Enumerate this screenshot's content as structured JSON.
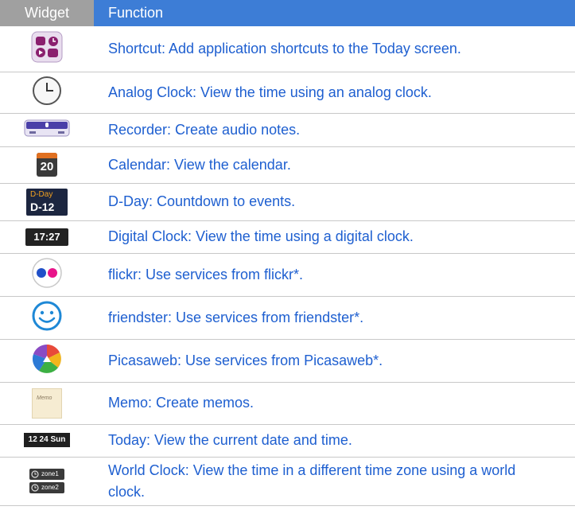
{
  "header": {
    "widget": "Widget",
    "function": "Function"
  },
  "rows": [
    {
      "icon": "shortcut-icon",
      "text": "Shortcut: Add application shortcuts to the Today screen."
    },
    {
      "icon": "analog-clock-icon",
      "text": "Analog Clock: View the time using an analog clock."
    },
    {
      "icon": "recorder-icon",
      "text": "Recorder: Create audio notes."
    },
    {
      "icon": "calendar-icon",
      "icon_text": "20",
      "text": "Calendar: View the calendar."
    },
    {
      "icon": "d-day-icon",
      "icon_text": "D-Day",
      "icon_text2": "D-12",
      "text": "D-Day: Countdown to events."
    },
    {
      "icon": "digital-clock-icon",
      "icon_text": "17:27",
      "text": "Digital Clock: View the time using a digital clock."
    },
    {
      "icon": "flickr-icon",
      "text": "flickr: Use services from flickr*."
    },
    {
      "icon": "friendster-icon",
      "text": "friendster: Use services from friendster*."
    },
    {
      "icon": "picasaweb-icon",
      "text": "Picasaweb: Use services from Picasaweb*."
    },
    {
      "icon": "memo-icon",
      "icon_text": "Memo",
      "text": "Memo: Create memos."
    },
    {
      "icon": "today-icon",
      "icon_text": "12 24 Sun",
      "text": "Today: View the current date and time."
    },
    {
      "icon": "world-clock-icon",
      "icon_text": "zone1",
      "icon_text2": "zone2",
      "text": "World Clock: View the time in a different time zone using a world clock."
    }
  ]
}
